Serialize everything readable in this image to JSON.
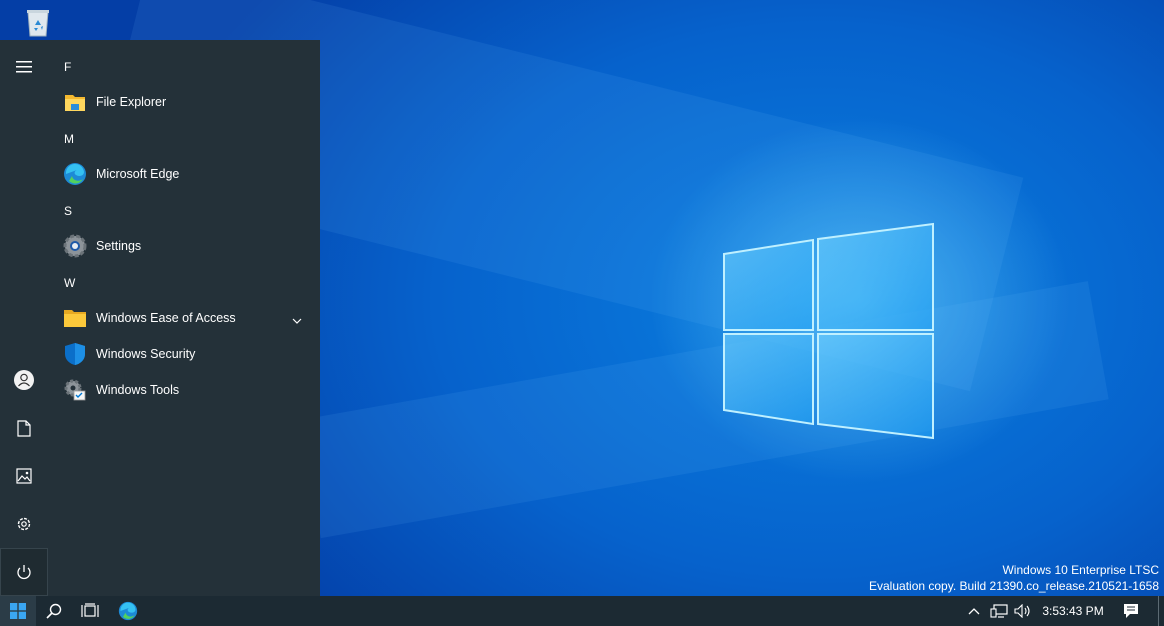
{
  "desktop": {
    "icons": [
      {
        "name": "recycle-bin-icon"
      }
    ],
    "watermark": {
      "line1": "Windows 10 Enterprise LTSC",
      "line2": "Evaluation copy. Build 21390.co_release.210521-1658"
    }
  },
  "start_menu": {
    "rail": [
      {
        "icon": "hamburger-menu-icon"
      },
      {
        "icon": "user-account-icon"
      },
      {
        "icon": "documents-icon"
      },
      {
        "icon": "pictures-icon"
      },
      {
        "icon": "settings-gear-icon"
      },
      {
        "icon": "power-icon"
      }
    ],
    "sections": [
      {
        "letter": "F",
        "apps": [
          {
            "label": "File Explorer",
            "icon": "file-explorer-icon"
          }
        ]
      },
      {
        "letter": "M",
        "apps": [
          {
            "label": "Microsoft Edge",
            "icon": "edge-icon"
          }
        ]
      },
      {
        "letter": "S",
        "apps": [
          {
            "label": "Settings",
            "icon": "settings-icon"
          }
        ]
      },
      {
        "letter": "W",
        "apps": [
          {
            "label": "Windows Ease of Access",
            "icon": "folder-icon",
            "expandable": true
          },
          {
            "label": "Windows Security",
            "icon": "shield-icon"
          },
          {
            "label": "Windows Tools",
            "icon": "windows-tools-icon"
          }
        ]
      }
    ]
  },
  "taskbar": {
    "buttons": [
      {
        "icon": "windows-start-icon"
      },
      {
        "icon": "search-icon"
      },
      {
        "icon": "task-view-icon"
      },
      {
        "icon": "edge-icon"
      }
    ],
    "tray": {
      "icons": [
        "chevron-up-icon",
        "network-icon",
        "volume-icon"
      ],
      "time": "3:53:43 PM",
      "notification_icon": "action-center-icon"
    }
  },
  "colors": {
    "start_menu_bg": "#243139",
    "taskbar_bg": "#1c2a33",
    "desktop_blue": "#0662cc",
    "accent": "#0078d4"
  }
}
